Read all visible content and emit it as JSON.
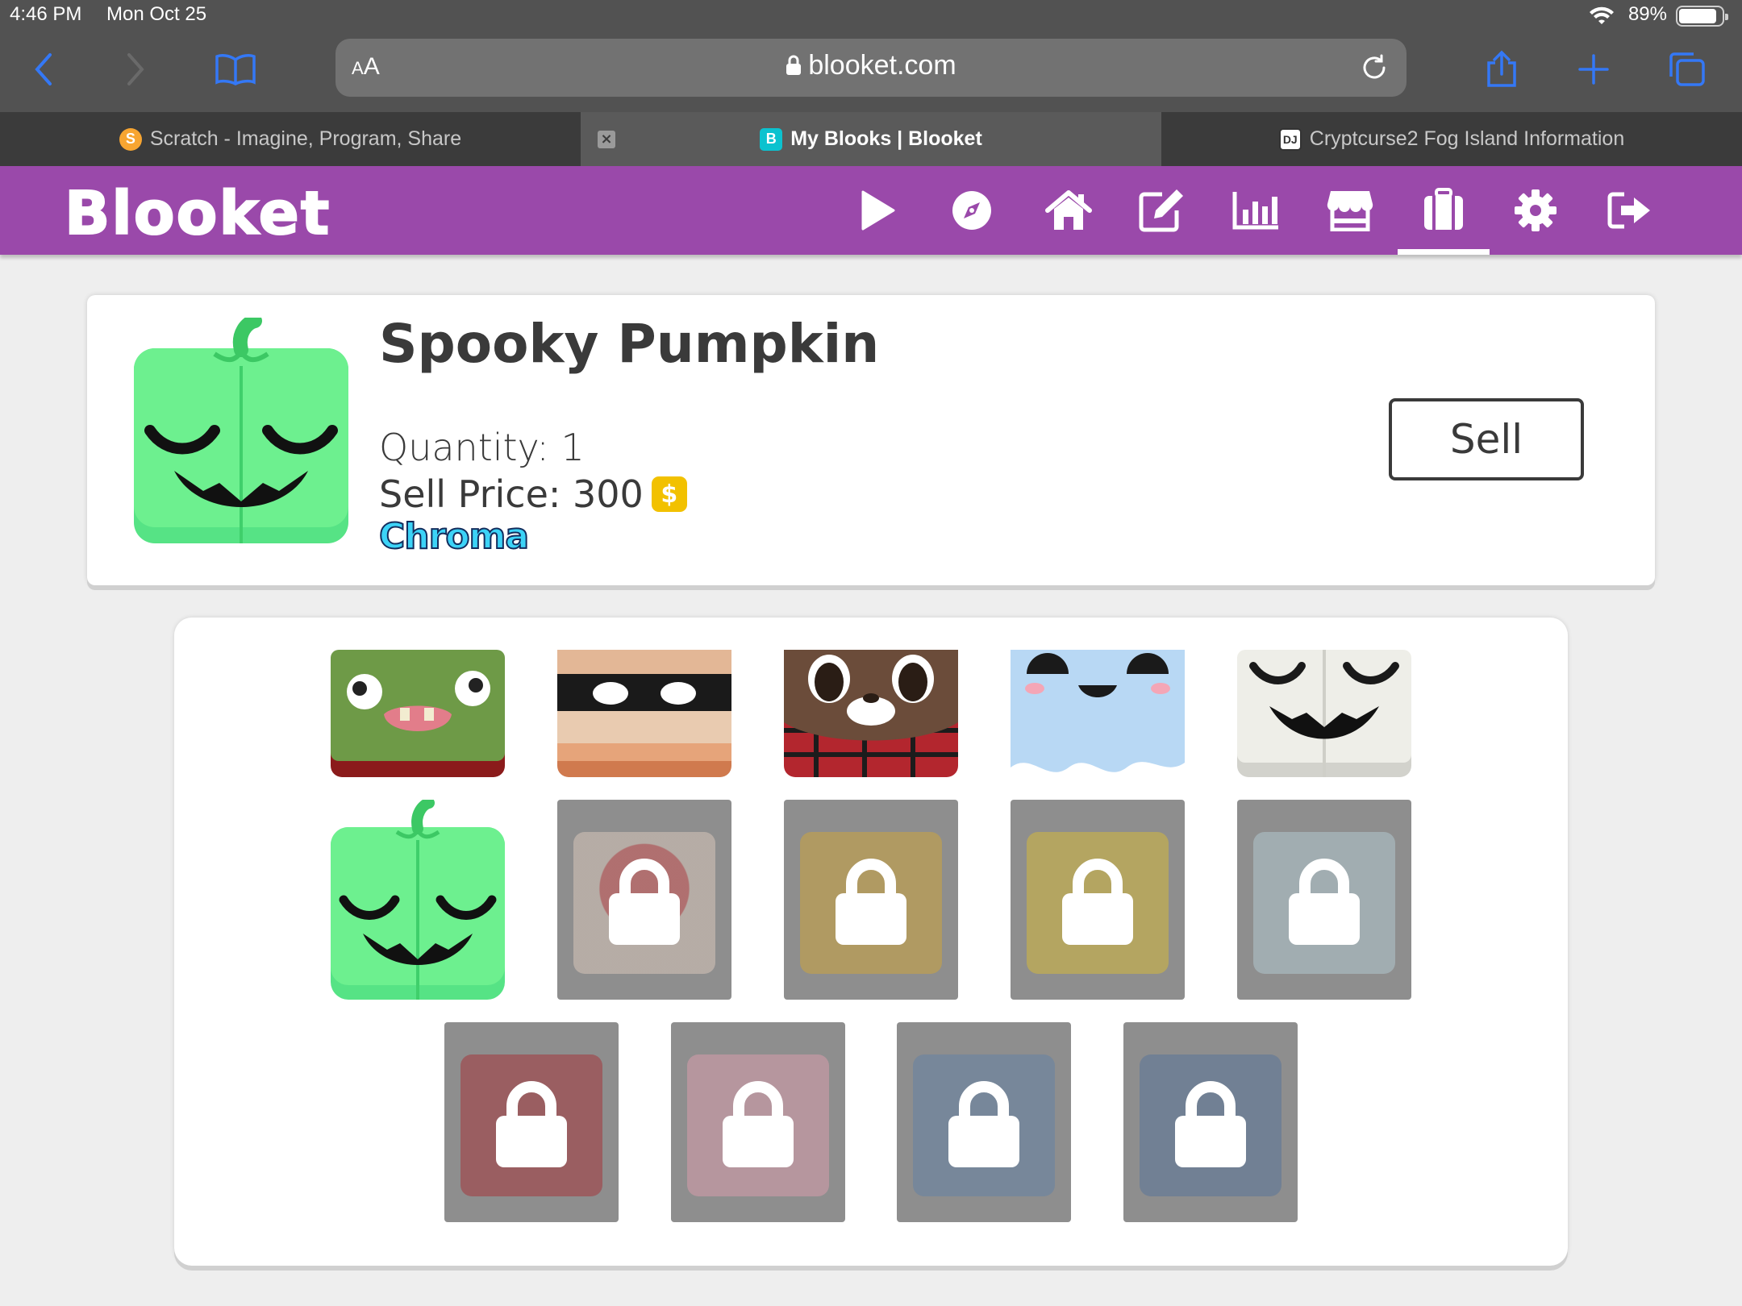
{
  "status_bar": {
    "time": "4:46 PM",
    "date": "Mon Oct 25",
    "battery": "89%",
    "battery_level": 0.89
  },
  "browser": {
    "text_size_label_small": "A",
    "text_size_label": "A",
    "url": "blooket.com",
    "tabs": [
      {
        "title": "Scratch - Imagine, Program, Share",
        "favicon": "S"
      },
      {
        "title": "My Blooks | Blooket",
        "favicon": "B"
      },
      {
        "title": "Cryptcurse2 Fog Island Information",
        "favicon": "DJ"
      }
    ],
    "accent": "#3478f6"
  },
  "app": {
    "logo": "Blooket",
    "brand_color": "#9a49aa",
    "nav_icons": [
      "play-icon",
      "compass-icon",
      "home-icon",
      "edit-icon",
      "stats-icon",
      "market-icon",
      "blooks-icon",
      "settings-icon",
      "logout-icon"
    ],
    "active_nav": "blooks-icon"
  },
  "selected_blook": {
    "name": "Spooky Pumpkin",
    "quantity_label": "Quantity: 1",
    "price_label": "Sell Price: 300",
    "coin_symbol": "$",
    "rarity": "Chroma",
    "sell_button": "Sell"
  },
  "blooks": [
    {
      "name": "zombie",
      "locked": false
    },
    {
      "name": "mummy",
      "locked": false
    },
    {
      "name": "werewolf",
      "locked": false
    },
    {
      "name": "ghost",
      "locked": false
    },
    {
      "name": "white-pumpkin",
      "locked": false
    },
    {
      "name": "spooky-pumpkin",
      "locked": false
    },
    {
      "name": "mushroom",
      "locked": true
    },
    {
      "name": "top-hat",
      "locked": true
    },
    {
      "name": "crown",
      "locked": true
    },
    {
      "name": "tv",
      "locked": true
    },
    {
      "name": "samurai",
      "locked": true
    },
    {
      "name": "pink",
      "locked": true
    },
    {
      "name": "blue-1",
      "locked": true
    },
    {
      "name": "blue-2",
      "locked": true
    }
  ]
}
